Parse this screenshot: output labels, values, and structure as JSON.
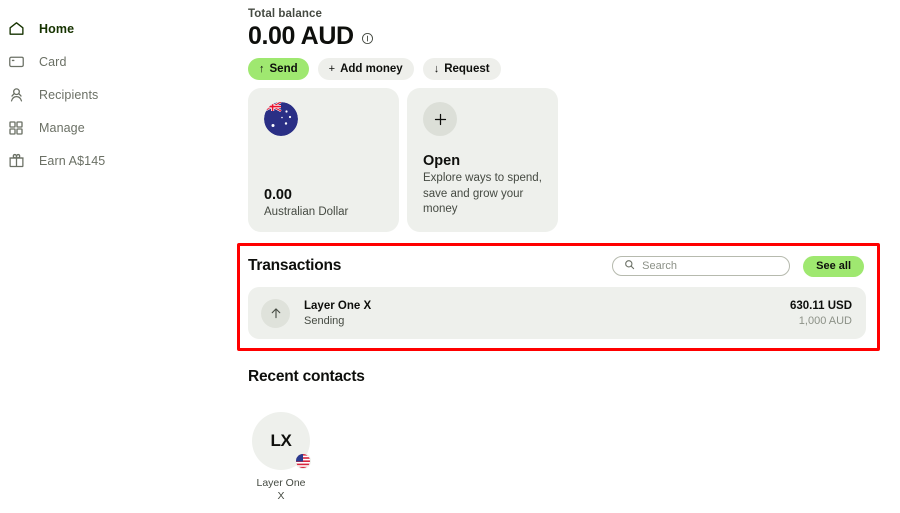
{
  "sidebar": {
    "items": [
      {
        "label": "Home",
        "icon": "home-icon",
        "active": true
      },
      {
        "label": "Card",
        "icon": "card-icon",
        "active": false
      },
      {
        "label": "Recipients",
        "icon": "recipients-icon",
        "active": false
      },
      {
        "label": "Manage",
        "icon": "grid-icon",
        "active": false
      },
      {
        "label": "Earn A$145",
        "icon": "gift-icon",
        "active": false
      }
    ]
  },
  "balance": {
    "label": "Total balance",
    "amount": "0.00 AUD",
    "info_icon": "info-circle-icon"
  },
  "actions": [
    {
      "label": "Send",
      "glyph": "↑",
      "icon": "arrow-up-icon",
      "primary": true
    },
    {
      "label": "Add money",
      "glyph": "+",
      "icon": "plus-icon",
      "primary": false
    },
    {
      "label": "Request",
      "glyph": "↓",
      "icon": "arrow-down-icon",
      "primary": false
    }
  ],
  "accounts": {
    "aud": {
      "flag": "australia-flag-icon",
      "amount": "0.00",
      "currency_name": "Australian Dollar"
    },
    "open": {
      "icon": "plus-icon",
      "title": "Open",
      "description_line1": "Explore ways to spend,",
      "description_line2": "save and grow your money"
    }
  },
  "transactions": {
    "title": "Transactions",
    "search": {
      "placeholder": "Search",
      "value": "",
      "icon": "search-icon"
    },
    "see_all_label": "See all",
    "rows": [
      {
        "icon": "arrow-up-icon",
        "name": "Layer One X",
        "status": "Sending",
        "amount_primary": "630.11 USD",
        "amount_secondary": "1,000 AUD"
      }
    ]
  },
  "recent_contacts": {
    "title": "Recent contacts",
    "items": [
      {
        "initials": "LX",
        "name_line1": "Layer One",
        "name_line2": "X",
        "flag": "usa-flag-icon"
      }
    ]
  },
  "colors": {
    "accent_green": "#9fe870",
    "card_bg": "#eef0ec",
    "text_primary": "#0e0f0c",
    "text_muted": "#454a42",
    "highlight_red": "#ff0000"
  }
}
